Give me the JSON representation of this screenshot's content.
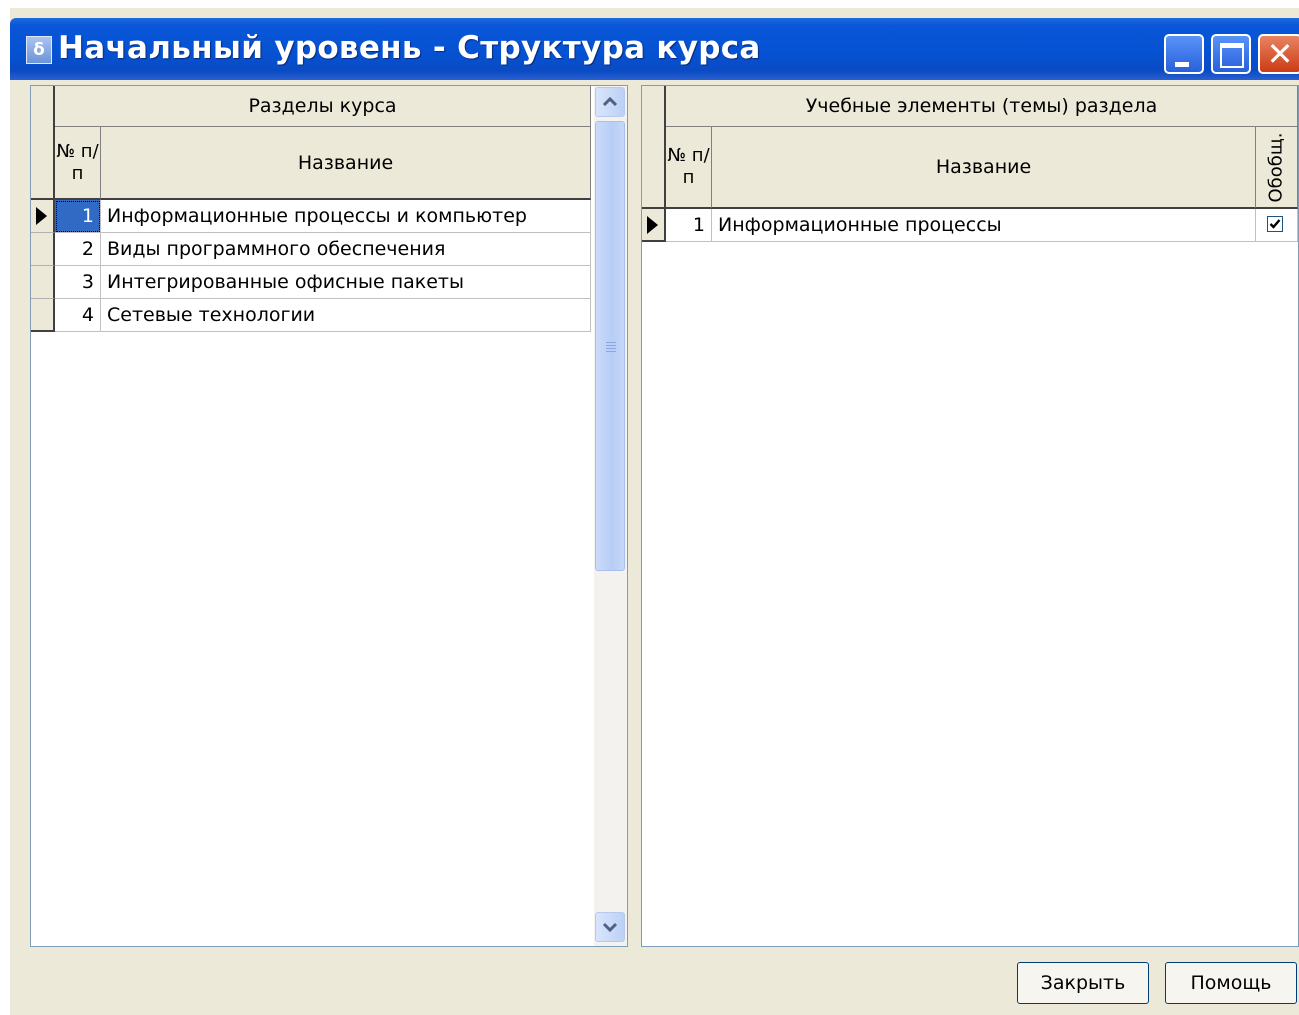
{
  "window": {
    "title": "Начальный уровень - Структура курса",
    "app_icon_glyph": "δ",
    "close_glyph": "✕"
  },
  "sections_grid": {
    "group_header": "Разделы курса",
    "col_num": "№ п/п",
    "col_name": "Название",
    "selected_index": 0,
    "rows": [
      {
        "num": "1",
        "name": "Информационные процессы и компьютер"
      },
      {
        "num": "2",
        "name": "Виды программного обеспечения"
      },
      {
        "num": "3",
        "name": "Интегрированные офисные пакеты"
      },
      {
        "num": "4",
        "name": "Сетевые технологии"
      }
    ]
  },
  "topics_grid": {
    "group_header": "Учебные элементы (темы) раздела",
    "col_num": "№ п/п",
    "col_name": "Название",
    "col_general": "Обобщ.",
    "rows": [
      {
        "num": "1",
        "name": "Информационные процессы",
        "general_checked": true
      }
    ]
  },
  "buttons": {
    "close_label": "Закрыть",
    "help_label": "Помощь"
  },
  "colors": {
    "title_bar": "#0552d3",
    "selection": "#316ac5",
    "window_bg": "#ece9d8"
  },
  "icons": {
    "app": "app-icon",
    "minimize": "minimize-icon",
    "maximize": "maximize-icon",
    "close": "close-icon",
    "row_pointer": "row-indicator-arrow-icon",
    "checkbox": "checkmark-icon",
    "scroll_up": "chevron-up-icon",
    "scroll_down": "chevron-down-icon"
  }
}
